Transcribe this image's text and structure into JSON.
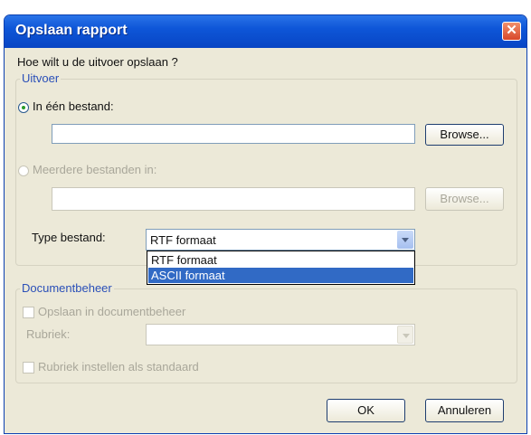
{
  "window": {
    "title": "Opslaan rapport",
    "close_glyph": "✕"
  },
  "prompt": "Hoe wilt u de uitvoer opslaan ?",
  "output_group": {
    "legend": "Uitvoer",
    "single_file": {
      "label": "In één bestand:",
      "selected": true,
      "value": "",
      "browse": "Browse..."
    },
    "multiple_files": {
      "label": "Meerdere bestanden in:",
      "selected": false,
      "value": "",
      "browse": "Browse..."
    },
    "file_type": {
      "label": "Type bestand:",
      "selected_value": "RTF formaat",
      "options": [
        "RTF formaat",
        "ASCII formaat"
      ],
      "highlighted_option": "ASCII formaat"
    }
  },
  "document_group": {
    "legend": "Documentbeheer",
    "save_in_dm": {
      "label": "Opslaan in documentbeheer",
      "checked": false
    },
    "rubriek": {
      "label": "Rubriek:",
      "value": ""
    },
    "set_default": {
      "label": "Rubriek instellen als standaard",
      "checked": false
    }
  },
  "buttons": {
    "ok": "OK",
    "cancel": "Annuleren"
  },
  "colors": {
    "titlebar": "#0e56d8",
    "accent": "#316ac5",
    "legend_text": "#2a4fb8",
    "close_button": "#d8472a"
  }
}
